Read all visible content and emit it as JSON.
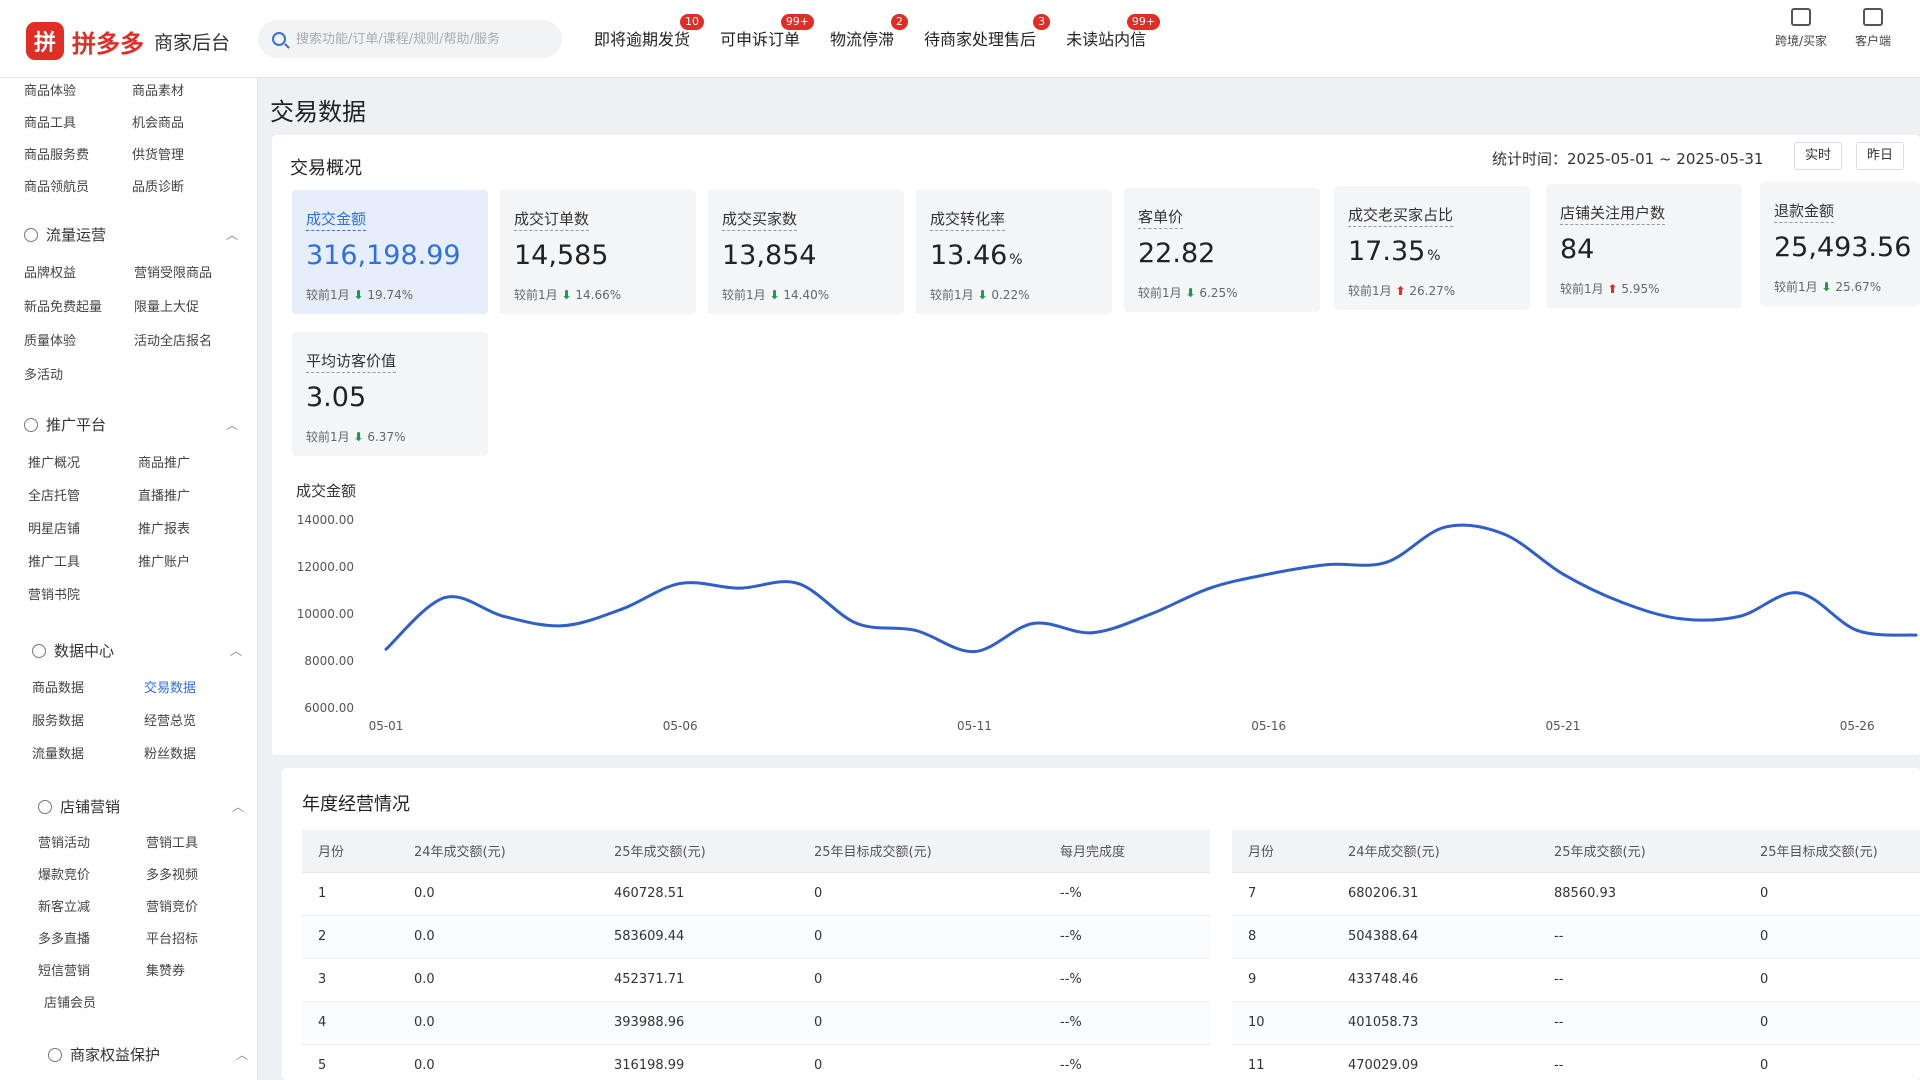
{
  "app": {
    "brand": "拼多多",
    "subtitle": "商家后台",
    "logo_char": "拼"
  },
  "search": {
    "placeholder": "搜索功能/订单/课程/规则/帮助/服务"
  },
  "topnav": [
    {
      "label": "即将逾期发货",
      "badge": "10"
    },
    {
      "label": "可申诉订单",
      "badge": "99+"
    },
    {
      "label": "物流停滞",
      "badge": "2"
    },
    {
      "label": "待商家处理售后",
      "badge": "3"
    },
    {
      "label": "未读站内信",
      "badge": "99+"
    }
  ],
  "tools": [
    {
      "label": "跨境/买家",
      "icon": "store-icon"
    },
    {
      "label": "客户端",
      "icon": "desktop-icon"
    }
  ],
  "sidebar": {
    "top_items": [
      "商品体验",
      "商品素材",
      "商品工具",
      "机会商品",
      "商品服务费",
      "供货管理",
      "商品领航员",
      "品质诊断"
    ],
    "sections": [
      {
        "title": "流量运营",
        "items": [
          "品牌权益",
          "营销受限商品",
          "新品免费起量",
          "限量上大促",
          "质量体验",
          "活动全店报名",
          "多活动"
        ]
      },
      {
        "title": "推广平台",
        "items": [
          "推广概况",
          "商品推广",
          "全店托管",
          "直播推广",
          "明星店铺",
          "推广报表",
          "推广工具",
          "推广账户",
          "营销书院"
        ]
      },
      {
        "title": "数据中心",
        "items": [
          "商品数据",
          "交易数据",
          "服务数据",
          "经营总览",
          "流量数据",
          "粉丝数据"
        ]
      },
      {
        "title": "店铺营销",
        "items": [
          "营销活动",
          "营销工具",
          "爆款竞价",
          "多多视频",
          "新客立减",
          "营销竞价",
          "多多直播",
          "平台招标",
          "短信营销",
          "集赞券",
          "店铺会员"
        ]
      },
      {
        "title": "商家权益保护",
        "items": []
      }
    ]
  },
  "main": {
    "page_title": "交易数据",
    "overview": {
      "title": "交易概况",
      "stat_time": "统计时间：2025-05-01 ~ 2025-05-31",
      "buttons": [
        "实时",
        "昨日"
      ],
      "metrics": [
        {
          "label": "成交金额",
          "value": "316,198.99",
          "unit": "",
          "cmp_label": "较前1月",
          "dir": "down",
          "arrow": "⬇",
          "pct": "19.74%"
        },
        {
          "label": "成交订单数",
          "value": "14,585",
          "unit": "",
          "cmp_label": "较前1月",
          "dir": "down",
          "arrow": "⬇",
          "pct": "14.66%"
        },
        {
          "label": "成交买家数",
          "value": "13,854",
          "unit": "",
          "cmp_label": "较前1月",
          "dir": "down",
          "arrow": "⬇",
          "pct": "14.40%"
        },
        {
          "label": "成交转化率",
          "value": "13.46",
          "unit": "%",
          "cmp_label": "较前1月",
          "dir": "down",
          "arrow": "⬇",
          "pct": "0.22%"
        },
        {
          "label": "客单价",
          "value": "22.82",
          "unit": "",
          "cmp_label": "较前1月",
          "dir": "down",
          "arrow": "⬇",
          "pct": "6.25%"
        },
        {
          "label": "成交老买家占比",
          "value": "17.35",
          "unit": "%",
          "cmp_label": "较前1月",
          "dir": "up",
          "arrow": "⬆",
          "pct": "26.27%"
        },
        {
          "label": "店铺关注用户数",
          "value": "84",
          "unit": "",
          "cmp_label": "较前1月",
          "dir": "up",
          "arrow": "⬆",
          "pct": "5.95%"
        },
        {
          "label": "退款金额",
          "value": "25,493.56",
          "unit": "",
          "cmp_label": "较前1月",
          "dir": "down",
          "arrow": "⬇",
          "pct": "25.67%"
        },
        {
          "label": "平均访客价值",
          "value": "3.05",
          "unit": "",
          "cmp_label": "较前1月",
          "dir": "down",
          "arrow": "⬇",
          "pct": "6.37%"
        }
      ],
      "chart_title": "成交金额"
    },
    "annual": {
      "title": "年度经营情况",
      "left_headers": [
        "月份",
        "24年成交额(元)",
        "25年成交额(元)",
        "25年目标成交额(元)",
        "每月完成度"
      ],
      "left_rows": [
        [
          "1",
          "0.0",
          "460728.51",
          "0",
          "--%"
        ],
        [
          "2",
          "0.0",
          "583609.44",
          "0",
          "--%"
        ],
        [
          "3",
          "0.0",
          "452371.71",
          "0",
          "--%"
        ],
        [
          "4",
          "0.0",
          "393988.96",
          "0",
          "--%"
        ],
        [
          "5",
          "0.0",
          "316198.99",
          "0",
          "--%"
        ]
      ],
      "right_headers": [
        "月份",
        "24年成交额(元)",
        "25年成交额(元)",
        "25年目标成交额(元)"
      ],
      "right_rows": [
        [
          "7",
          "680206.31",
          "88560.93",
          "0"
        ],
        [
          "8",
          "504388.64",
          "--",
          "0"
        ],
        [
          "9",
          "433748.46",
          "--",
          "0"
        ],
        [
          "10",
          "401058.73",
          "--",
          "0"
        ],
        [
          "11",
          "470029.09",
          "--",
          "0"
        ]
      ]
    }
  },
  "colors": {
    "brand": "#e02e24",
    "accent": "#2f6fe0",
    "line": "#2f5fc8",
    "down": "#1a9a4a",
    "up": "#e02e24"
  },
  "chart_data": {
    "type": "line",
    "title": "成交金额",
    "x": [
      "05-01",
      "05-02",
      "05-03",
      "05-04",
      "05-05",
      "05-06",
      "05-07",
      "05-08",
      "05-09",
      "05-10",
      "05-11",
      "05-12",
      "05-13",
      "05-14",
      "05-15",
      "05-16",
      "05-17",
      "05-18",
      "05-19",
      "05-20",
      "05-21",
      "05-22",
      "05-23",
      "05-24",
      "05-25",
      "05-26",
      "05-27"
    ],
    "x_ticks": [
      "05-01",
      "05-06",
      "05-11",
      "05-16",
      "05-21",
      "05-26"
    ],
    "y_ticks": [
      "14000.00",
      "12000.00",
      "10000.00",
      "8000.00",
      "6000.00"
    ],
    "values": [
      8500,
      10700,
      9900,
      9500,
      10200,
      11300,
      11100,
      11300,
      9600,
      9300,
      8400,
      9600,
      9200,
      10000,
      11100,
      11700,
      12100,
      12200,
      13700,
      13400,
      11700,
      10500,
      9800,
      9900,
      10900,
      9300,
      9100
    ],
    "ylim": [
      6000,
      14000
    ],
    "grid": false
  }
}
